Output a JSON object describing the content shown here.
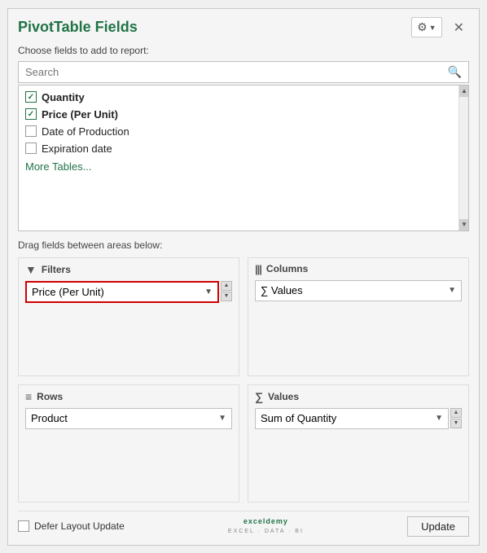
{
  "panel": {
    "title": "PivotTable Fields",
    "choose_fields_label": "Choose fields to add to report:",
    "search_placeholder": "Search",
    "drag_fields_label": "Drag fields between areas below:",
    "fields": [
      {
        "id": "quantity",
        "label": "Quantity",
        "checked": true,
        "bold": true
      },
      {
        "id": "price",
        "label": "Price (Per Unit)",
        "checked": true,
        "bold": true
      },
      {
        "id": "date_of_production",
        "label": "Date of Production",
        "checked": false,
        "bold": false
      },
      {
        "id": "expiration_date",
        "label": "Expiration date",
        "checked": false,
        "bold": false
      }
    ],
    "more_tables_label": "More Tables...",
    "areas": {
      "filters": {
        "label": "Filters",
        "value": "Price (Per Unit)",
        "highlighted": true
      },
      "columns": {
        "label": "Columns",
        "value": "∑  Values",
        "highlighted": false
      },
      "rows": {
        "label": "Rows",
        "value": "Product",
        "highlighted": false
      },
      "values": {
        "label": "Values",
        "value": "Sum of Quantity",
        "highlighted": false
      }
    },
    "defer_label": "Defer Layout Update",
    "update_label": "Update",
    "icons": {
      "settings": "⚙",
      "dropdown_arrow": "▼",
      "close": "✕",
      "search": "🔍",
      "scroll_up": "▲",
      "scroll_down": "▼",
      "filter_icon": "▼",
      "rows_icon": "≡",
      "columns_icon": "|||",
      "values_icon": "∑"
    }
  }
}
